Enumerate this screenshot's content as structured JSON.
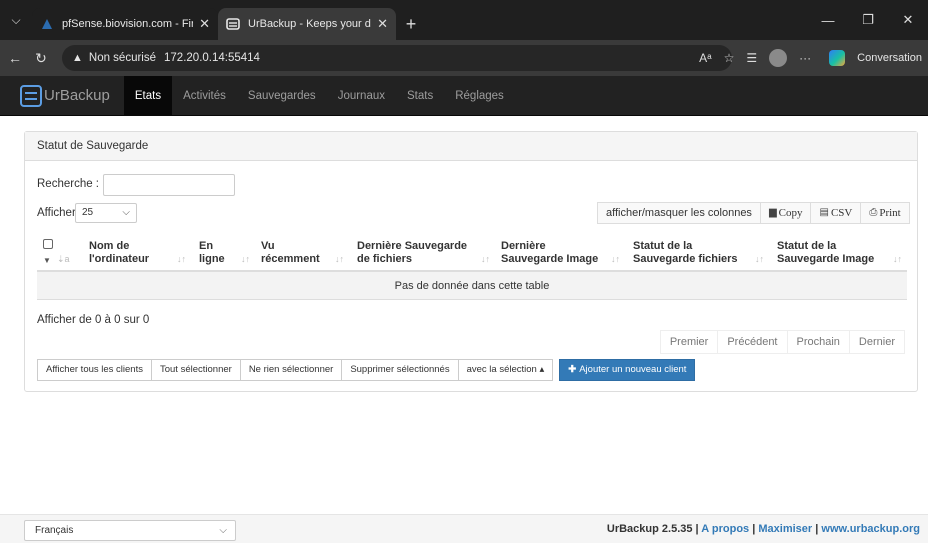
{
  "browser": {
    "tabs": [
      {
        "title": "pfSense.biovision.com - Firewall: Rules",
        "close": "✕"
      },
      {
        "title": "UrBackup - Keeps your data safe",
        "close": "✕"
      }
    ],
    "new_tab": "+",
    "address": {
      "warning": "Non sécurisé",
      "url": "172.20.0.14:55414"
    },
    "profile_label": "Conversation"
  },
  "nav": {
    "brand": "UrBackup",
    "items": [
      "Etats",
      "Activités",
      "Sauvegardes",
      "Journaux",
      "Stats",
      "Réglages"
    ],
    "active": 0
  },
  "panel": {
    "heading": "Statut de Sauvegarde",
    "search_label": "Recherche :",
    "show_label": "Afficher",
    "page_length": "25",
    "buttons": {
      "colvis": "afficher/masquer les colonnes",
      "copy": "Copy",
      "csv": "CSV",
      "print": "Print"
    },
    "columns": [
      {
        "line1": "Nom de",
        "line2": "l'ordinateur"
      },
      {
        "line1": "En",
        "line2": "ligne"
      },
      {
        "line1": "Vu",
        "line2": "récemment"
      },
      {
        "line1": "Dernière Sauvegarde",
        "line2": "de fichiers"
      },
      {
        "line1": "Dernière",
        "line2": "Sauvegarde Image"
      },
      {
        "line1": "Statut de la",
        "line2": "Sauvegarde fichiers"
      },
      {
        "line1": "Statut de la",
        "line2": "Sauvegarde Image"
      }
    ],
    "empty_message": "Pas de donnée dans cette table",
    "info": "Afficher de 0 à 0 sur 0",
    "pagination": [
      "Premier",
      "Précédent",
      "Prochain",
      "Dernier"
    ],
    "actions": {
      "show_all": "Afficher tous les clients",
      "select_all": "Tout sélectionner",
      "select_none": "Ne rien sélectionner",
      "delete_selected": "Supprimer sélectionnés",
      "with_selection": "avec la sélection ▴",
      "add_client": "Ajouter un nouveau client"
    }
  },
  "footer": {
    "language": "Français",
    "version": "UrBackup 2.5.35",
    "sep": " | ",
    "about": "A propos",
    "maximize": "Maximiser",
    "site": "www.urbackup.org"
  },
  "colors": {
    "navbar": "#222222",
    "primary": "#337ab7",
    "link": "#337ab7"
  }
}
